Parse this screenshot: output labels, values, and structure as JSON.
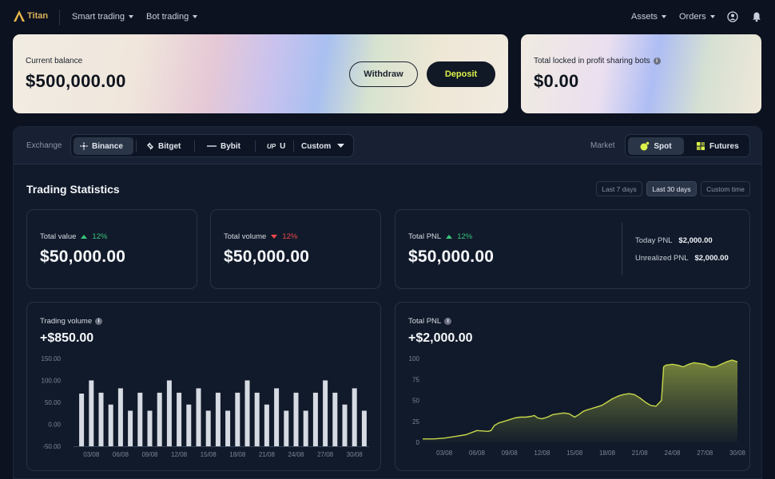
{
  "brand": {
    "logo_text": "Titan"
  },
  "nav": {
    "smart_trading": "Smart trading",
    "bot_trading": "Bot trading",
    "assets": "Assets",
    "orders": "Orders"
  },
  "balance": {
    "label": "Current balance",
    "value": "$500,000.00",
    "withdraw": "Withdraw",
    "deposit": "Deposit"
  },
  "locked": {
    "label": "Total locked in profit sharing bots",
    "value": "$0.00"
  },
  "filters": {
    "exchange_label": "Exchange",
    "exchanges": [
      "Binance",
      "Bitget",
      "Bybit",
      "U"
    ],
    "custom": "Custom",
    "market_label": "Market",
    "markets": [
      "Spot",
      "Futures"
    ]
  },
  "stats": {
    "title": "Trading Statistics",
    "ranges": [
      "Last 7 days",
      "Last 30 days",
      "Custom time"
    ],
    "total_value": {
      "label": "Total value",
      "pct": "12%",
      "value": "$50,000.00"
    },
    "total_volume": {
      "label": "Total volume",
      "pct": "12%",
      "value": "$50,000.00"
    },
    "total_pnl": {
      "label": "Total PNL",
      "pct": "12%",
      "value": "$50,000.00"
    },
    "today_pnl": {
      "label": "Today PNL",
      "value": "$2,000.00"
    },
    "unrealized_pnl": {
      "label": "Unrealized PNL",
      "value": "$2,000.00"
    }
  },
  "volume_chart": {
    "title": "Trading volume",
    "value": "+$850.00"
  },
  "pnl_chart": {
    "title": "Total PNL",
    "value": "+$2,000.00"
  },
  "colors": {
    "accent": "#dcf14a",
    "up": "#38c47a",
    "down": "#f0494a",
    "bar": "#d6dae2",
    "area": "#c8d94a"
  },
  "chart_data": [
    {
      "type": "bar",
      "ylim": [
        -50,
        150
      ],
      "yticks": [
        "150.00",
        "100.00",
        "50.00",
        "0.00",
        "-50.00"
      ],
      "xticks": [
        "03/08",
        "06/08",
        "09/08",
        "12/08",
        "15/08",
        "18/08",
        "21/08",
        "24/08",
        "27/08",
        "30/08"
      ],
      "values": [
        70,
        100,
        72,
        45,
        82,
        31,
        72,
        31,
        72,
        100,
        72,
        45,
        82,
        31,
        72,
        31,
        72,
        100,
        72,
        45,
        82,
        31,
        72,
        31,
        72,
        100,
        72,
        45,
        82,
        31
      ]
    },
    {
      "type": "area",
      "ylim": [
        0,
        100
      ],
      "yticks": [
        "100",
        "75",
        "50",
        "25",
        "0"
      ],
      "xticks": [
        "03/08",
        "06/08",
        "09/08",
        "12/08",
        "15/08",
        "18/08",
        "21/08",
        "24/08",
        "27/08",
        "30/08"
      ],
      "x": [
        1,
        2,
        3,
        4,
        5,
        6,
        7,
        7.3,
        7.6,
        8,
        8.5,
        9,
        9.5,
        10,
        10.5,
        11,
        11.3,
        11.6,
        12,
        12.5,
        13,
        13.5,
        14,
        14.5,
        15,
        15.4,
        15.8,
        16,
        16.5,
        17,
        17.5,
        18,
        18.5,
        19,
        19.5,
        20,
        20.5,
        21,
        21.5,
        22,
        22.5,
        23,
        23.2,
        23.4,
        24,
        24.5,
        25,
        25.5,
        26,
        26.5,
        27,
        27.5,
        28,
        28.5,
        29,
        29.5,
        30
      ],
      "values": [
        4,
        4,
        5,
        7,
        9,
        14,
        13,
        14,
        20,
        23,
        25,
        27,
        29,
        30,
        30,
        31,
        32,
        29,
        28,
        30,
        33,
        34,
        35,
        34,
        30,
        33,
        37,
        38,
        40,
        42,
        44,
        48,
        52,
        55,
        57,
        58,
        57,
        53,
        48,
        44,
        43,
        50,
        90,
        92,
        93,
        92,
        90,
        93,
        95,
        94,
        93,
        90,
        90,
        93,
        96,
        98,
        96
      ]
    }
  ]
}
